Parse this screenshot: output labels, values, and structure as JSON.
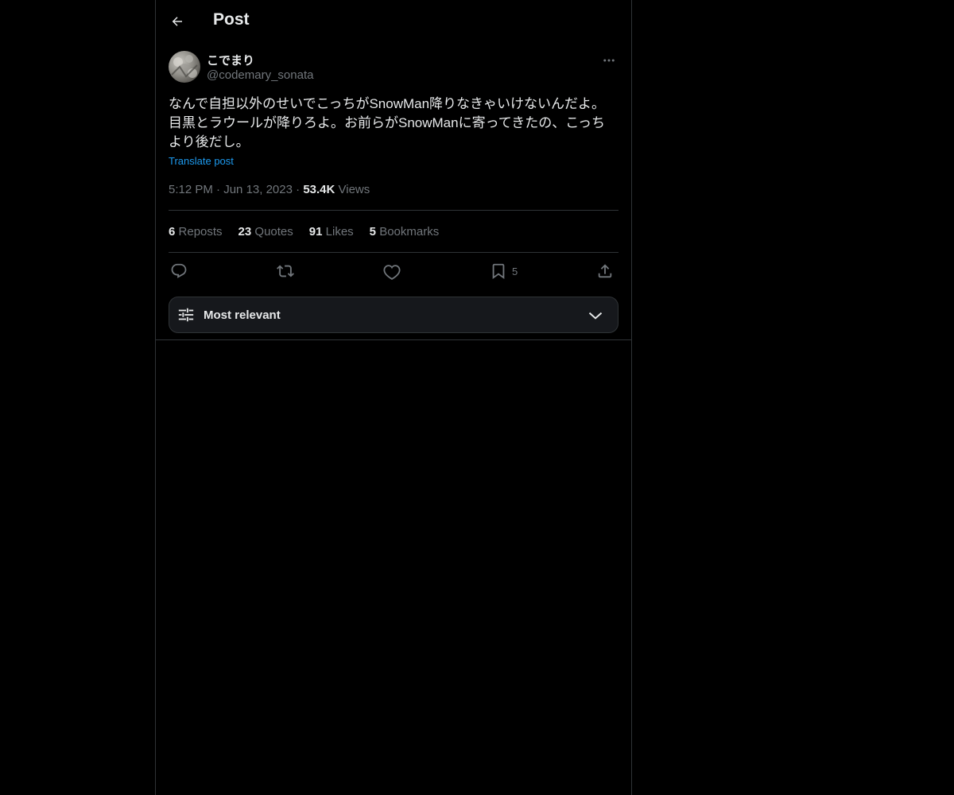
{
  "header": {
    "title": "Post"
  },
  "post": {
    "author_name": "こでまり",
    "author_handle": "@codemary_sonata",
    "text": "なんで自担以外のせいでこっちがSnowMan降りなきゃいけないんだよ。\n目黒とラウールが降りろよ。お前らがSnowManに寄ってきたの、こっち\nより後だし。",
    "translate_label": "Translate post",
    "time": "5:12 PM",
    "date": "Jun 13, 2023",
    "views_count": "53.4K",
    "views_label": "Views",
    "separator": "·"
  },
  "stats": {
    "reposts_count": "6",
    "reposts_label": "Reposts",
    "quotes_count": "23",
    "quotes_label": "Quotes",
    "likes_count": "91",
    "likes_label": "Likes",
    "bookmarks_count": "5",
    "bookmarks_label": "Bookmarks"
  },
  "actions": {
    "reply_icon": "reply-icon",
    "repost_icon": "repost-icon",
    "like_icon": "heart-icon",
    "bookmark_icon": "bookmark-icon",
    "bookmark_count": "5",
    "share_icon": "share-icon"
  },
  "sort": {
    "label": "Most relevant"
  },
  "colors": {
    "background": "#000000",
    "text": "#e7e9ea",
    "muted": "#71767b",
    "link": "#1d9bf0",
    "border": "#2f3336"
  }
}
